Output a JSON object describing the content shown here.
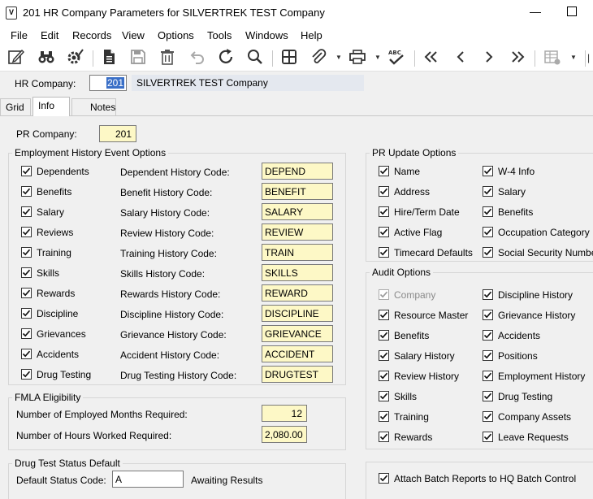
{
  "window": {
    "title": "201 HR Company Parameters for SILVERTREK TEST Company",
    "app_icon": "V"
  },
  "menu": [
    "File",
    "Edit",
    "Records",
    "View",
    "Options",
    "Tools",
    "Windows",
    "Help"
  ],
  "toolbar": {
    "icons": [
      "edit-icon",
      "binoculars-icon",
      "gear-check-icon",
      "document-icon",
      "save-icon",
      "delete-icon",
      "undo-icon",
      "refresh-icon",
      "search-icon",
      "calculator-icon",
      "attach-icon",
      "print-icon",
      "spellcheck-icon",
      "first-record-icon",
      "previous-record-icon",
      "next-record-icon",
      "last-record-icon",
      "grid-settings-icon"
    ]
  },
  "header": {
    "hr_company_label": "HR Company:",
    "hr_company_value": "201",
    "hr_company_name": "SILVERTREK TEST Company"
  },
  "tabs": [
    "Grid",
    "Info",
    "Notes"
  ],
  "active_tab": "Info",
  "pr_company": {
    "label": "PR Company:",
    "value": "201"
  },
  "employment_history": {
    "title": "Employment History Event Options",
    "rows": [
      {
        "check": "Dependents",
        "code_label": "Dependent History Code:",
        "code": "DEPEND"
      },
      {
        "check": "Benefits",
        "code_label": "Benefit History Code:",
        "code": "BENEFIT"
      },
      {
        "check": "Salary",
        "code_label": "Salary History Code:",
        "code": "SALARY"
      },
      {
        "check": "Reviews",
        "code_label": "Review History Code:",
        "code": "REVIEW"
      },
      {
        "check": "Training",
        "code_label": "Training History Code:",
        "code": "TRAIN"
      },
      {
        "check": "Skills",
        "code_label": "Skills History Code:",
        "code": "SKILLS"
      },
      {
        "check": "Rewards",
        "code_label": "Rewards History Code:",
        "code": "REWARD"
      },
      {
        "check": "Discipline",
        "code_label": "Discipline History Code:",
        "code": "DISCIPLINE"
      },
      {
        "check": "Grievances",
        "code_label": "Grievance History Code:",
        "code": "GRIEVANCE"
      },
      {
        "check": "Accidents",
        "code_label": "Accident History Code:",
        "code": "ACCIDENT"
      },
      {
        "check": "Drug Testing",
        "code_label": "Drug Testing History Code:",
        "code": "DRUGTEST"
      }
    ]
  },
  "fmla": {
    "title": "FMLA Eligibility",
    "months_label": "Number of Employed Months Required:",
    "months_value": "12",
    "hours_label": "Number of Hours Worked Required:",
    "hours_value": "2,080.00"
  },
  "drug_test": {
    "title": "Drug Test Status Default",
    "status_label": "Default Status Code:",
    "status_value": "A",
    "status_desc": "Awaiting Results"
  },
  "pr_update": {
    "title": "PR Update Options",
    "left": [
      "Name",
      "Address",
      "Hire/Term Date",
      "Active Flag",
      "Timecard Defaults"
    ],
    "right": [
      "W-4 Info",
      "Salary",
      "Benefits",
      "Occupation Category",
      "Social Security Number"
    ]
  },
  "audit": {
    "title": "Audit Options",
    "left": [
      "Company",
      "Resource Master",
      "Benefits",
      "Salary History",
      "Review History",
      "Skills",
      "Training",
      "Rewards"
    ],
    "right": [
      "Discipline  History",
      "Grievance  History",
      "Accidents",
      "Positions",
      "Employment  History",
      "Drug Testing",
      "Company Assets",
      "Leave Requests"
    ]
  },
  "attach_batch": "Attach Batch Reports to HQ Batch Control"
}
